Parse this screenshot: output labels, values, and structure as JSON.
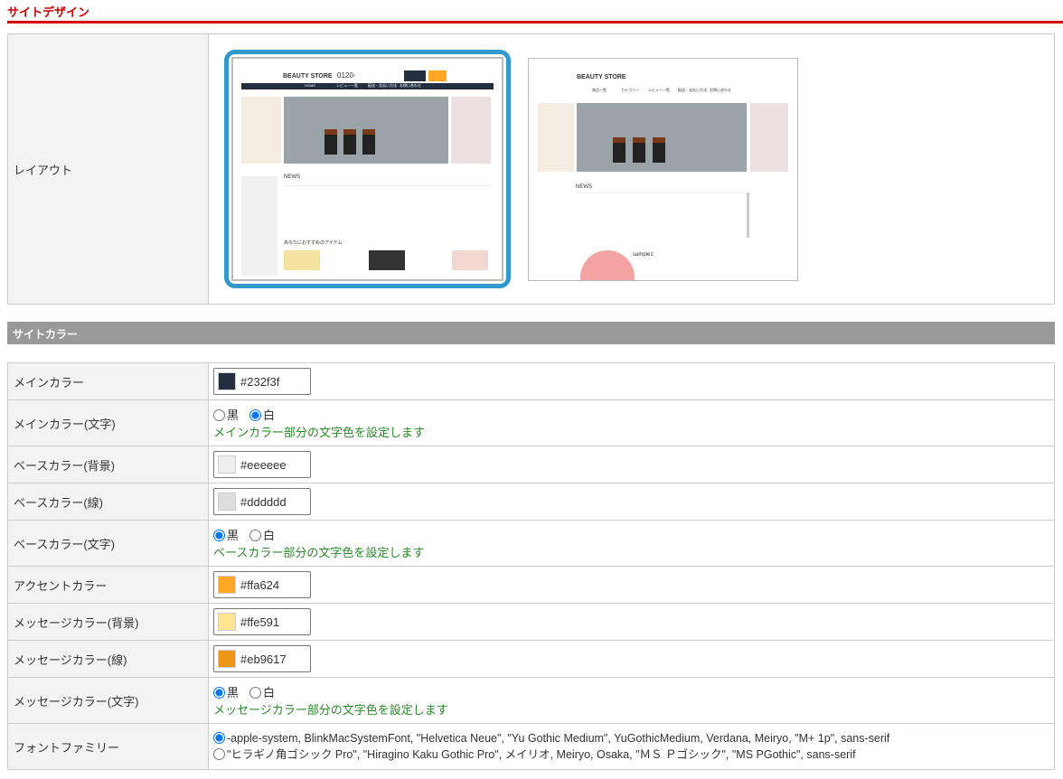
{
  "design": {
    "title": "サイトデザイン",
    "layout_label": "レイアウト",
    "thumbs": [
      {
        "logo": "BEAUTY STORE",
        "phone": "0120-",
        "nav": [
          "HOME",
          "レビュー一覧",
          "配送・支払い方法",
          "お問い合わせ"
        ],
        "news": "NEWS",
        "recommend": "あなたにおすすめのアイテム",
        "selected": true
      },
      {
        "logo": "BEAUTY STORE",
        "nav": [
          "商品一覧",
          "カテゴリー",
          "レビュー一覧",
          "配送・支払い方法",
          "お問い合わせ"
        ],
        "news": "NEWS",
        "sample": "sample1",
        "selected": false
      }
    ]
  },
  "colors": {
    "title": "サイトカラー",
    "help_main": "メインカラー部分の文字色を設定します",
    "help_base": "ベースカラー部分の文字色を設定します",
    "help_msg": "メッセージカラー部分の文字色を設定します",
    "black": "黒",
    "white": "白",
    "rows": {
      "main": {
        "label": "メインカラー",
        "value": "#232f3f"
      },
      "main_text": {
        "label": "メインカラー(文字)",
        "selected": "白"
      },
      "base_bg": {
        "label": "ベースカラー(背景)",
        "value": "#eeeeee"
      },
      "base_line": {
        "label": "ベースカラー(線)",
        "value": "#dddddd"
      },
      "base_text": {
        "label": "ベースカラー(文字)",
        "selected": "黒"
      },
      "accent": {
        "label": "アクセントカラー",
        "value": "#ffa624"
      },
      "msg_bg": {
        "label": "メッセージカラー(背景)",
        "value": "#ffe591"
      },
      "msg_line": {
        "label": "メッセージカラー(線)",
        "value": "#eb9617"
      },
      "msg_text": {
        "label": "メッセージカラー(文字)",
        "selected": "黒"
      },
      "font": {
        "label": "フォントファミリー",
        "options": [
          "-apple-system, BlinkMacSystemFont, \"Helvetica Neue\", \"Yu Gothic Medium\", YuGothicMedium, Verdana, Meiryo, \"M+ 1p\", sans-serif",
          "\"ヒラギノ角ゴシック Pro\", \"Hiragino Kaku Gothic Pro\", メイリオ, Meiryo, Osaka, \"ＭＳ Ｐゴシック\", \"MS PGothic\", sans-serif"
        ],
        "selected": 0
      }
    }
  }
}
